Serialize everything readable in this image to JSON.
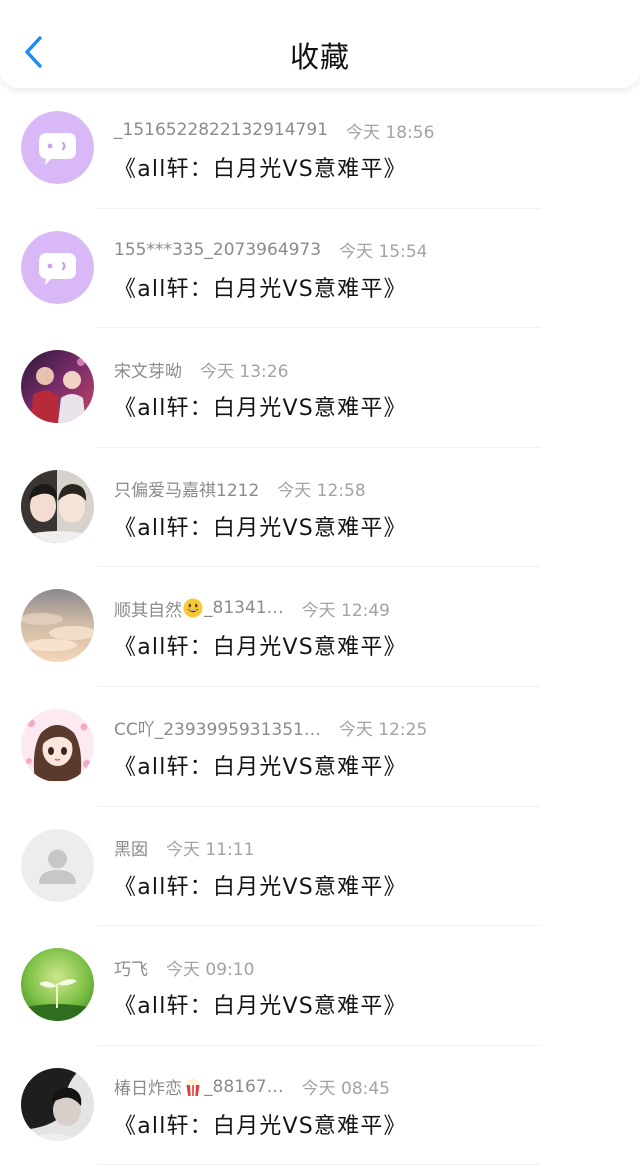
{
  "header": {
    "title": "收藏"
  },
  "items": [
    {
      "name": "_1516522822132914791",
      "time": "今天 18:56",
      "title": "《all轩：白月光VS意难平》",
      "avatar": "bot-purple"
    },
    {
      "name": "155***335_2073964973",
      "time": "今天 15:54",
      "title": "《all轩：白月光VS意难平》",
      "avatar": "bot-purple"
    },
    {
      "name": "宋文芽呦",
      "time": "今天 13:26",
      "title": "《all轩：白月光VS意难平》",
      "avatar": "photo-stage"
    },
    {
      "name": "只偏爱马嘉祺1212",
      "time": "今天 12:58",
      "title": "《all轩：白月光VS意难平》",
      "avatar": "photo-faces"
    },
    {
      "name_pre": "顺其自然",
      "emoji": "grinning-face",
      "name_post": "_81341…",
      "time": "今天 12:49",
      "title": "《all轩：白月光VS意难平》",
      "avatar": "photo-clouds"
    },
    {
      "name": "CC吖_2393995931351…",
      "time": "今天 12:25",
      "title": "《all轩：白月光VS意难平》",
      "avatar": "cartoon-girl"
    },
    {
      "name": "黑囡",
      "time": "今天 11:11",
      "title": "《all轩：白月光VS意难平》",
      "avatar": "default-user"
    },
    {
      "name": "巧飞",
      "time": "今天 09:10",
      "title": "《all轩：白月光VS意难平》",
      "avatar": "photo-sprout"
    },
    {
      "name_pre": "椿日炸恋",
      "emoji": "popcorn",
      "name_post": "_88167…",
      "time": "今天 08:45",
      "title": "《all轩：白月光VS意难平》",
      "avatar": "photo-dark"
    }
  ],
  "colors": {
    "accent": "#1a8cf2",
    "bot_avatar": "#d9b8f7",
    "default_avatar": "#ededed"
  }
}
